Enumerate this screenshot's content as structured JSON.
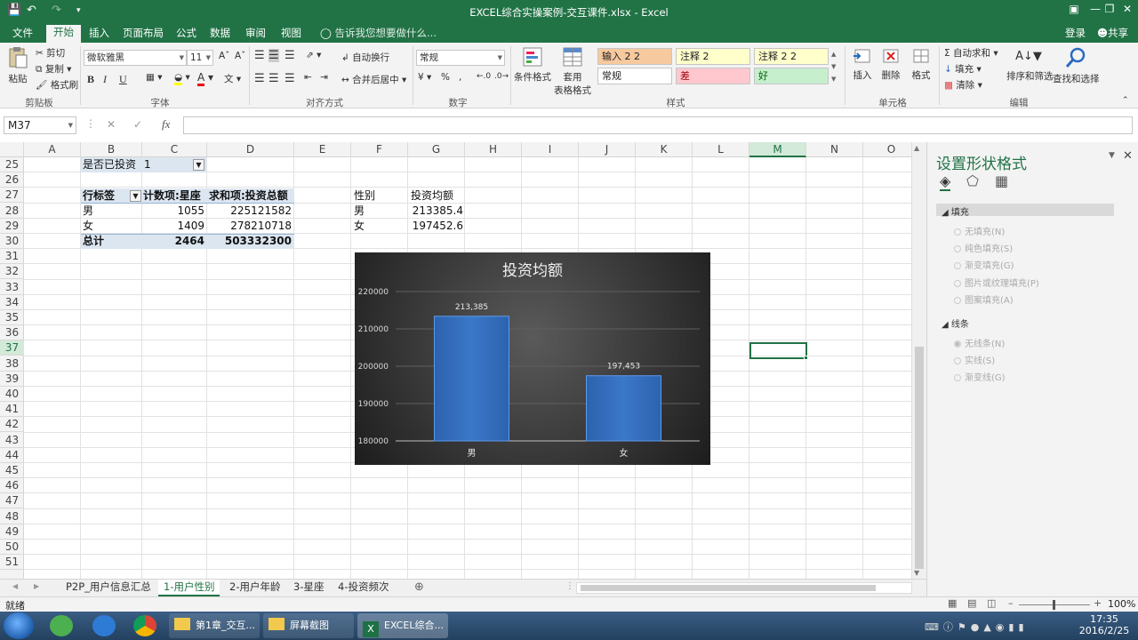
{
  "window": {
    "title": "EXCEL综合实操案例-交互课件.xlsx - Excel"
  },
  "ribbon_tabs": [
    "文件",
    "开始",
    "插入",
    "页面布局",
    "公式",
    "数据",
    "审阅",
    "视图"
  ],
  "tell_me": "告诉我您想要做什么...",
  "account": {
    "login": "登录",
    "share": "共享"
  },
  "clipboard": {
    "paste": "粘贴",
    "cut": "剪切",
    "copy": "复制",
    "format_painter": "格式刷",
    "label": "剪贴板"
  },
  "font": {
    "name": "微软雅黑",
    "size": "11",
    "bold": "B",
    "italic": "I",
    "underline": "U",
    "label": "字体"
  },
  "alignment": {
    "wrap": "自动换行",
    "merge": "合并后居中",
    "label": "对齐方式"
  },
  "number": {
    "format": "常规",
    "label": "数字"
  },
  "styles": {
    "cond": "条件格式",
    "table1": "套用",
    "table2": "表格格式",
    "label": "样式",
    "cells": [
      {
        "text": "输入 2 2",
        "bg": "#f7c99e"
      },
      {
        "text": "注释 2",
        "bg": "#ffffcc"
      },
      {
        "text": "注释 2 2",
        "bg": "#ffffcc"
      },
      {
        "text": "常规",
        "bg": "#ffffff"
      },
      {
        "text": "差",
        "bg": "#ffc7ce"
      },
      {
        "text": "好",
        "bg": "#c6efce"
      }
    ]
  },
  "cells_group": {
    "insert": "插入",
    "delete": "删除",
    "format": "格式",
    "label": "单元格"
  },
  "editing": {
    "autosum": "自动求和",
    "fill": "填充",
    "clear": "清除",
    "sort": "排序和筛选",
    "find": "查找和选择",
    "label": "编辑"
  },
  "formula_bar": {
    "name_box": "M37",
    "fx": "fx",
    "value": ""
  },
  "columns": [
    "A",
    "B",
    "C",
    "D",
    "E",
    "F",
    "G",
    "H",
    "I",
    "J",
    "K",
    "L",
    "M",
    "N",
    "O"
  ],
  "rows": [
    "25",
    "26",
    "27",
    "28",
    "29",
    "30",
    "31",
    "32",
    "33",
    "34",
    "35",
    "36",
    "37",
    "38",
    "39",
    "40",
    "41",
    "42",
    "43",
    "44",
    "45",
    "46",
    "47",
    "48",
    "49",
    "50",
    "51"
  ],
  "pivot": {
    "filter_label": "是否已投资",
    "filter_value": "1",
    "headers": [
      "行标签",
      "计数项:星座",
      "求和项:投资总额"
    ],
    "rows": [
      [
        "男",
        "1055",
        "225121582"
      ],
      [
        "女",
        "1409",
        "278210718"
      ]
    ],
    "total": [
      "总计",
      "2464",
      "503332300"
    ]
  },
  "avg_table": {
    "headers": [
      "性别",
      "投资均额"
    ],
    "rows": [
      [
        "男",
        "213385.4"
      ],
      [
        "女",
        "197452.6"
      ]
    ]
  },
  "chart_data": {
    "type": "bar",
    "title": "投资均额",
    "categories": [
      "男",
      "女"
    ],
    "values": [
      213385,
      197453
    ],
    "data_labels": [
      "213,385",
      "197,453"
    ],
    "ylim": [
      180000,
      220000
    ],
    "yticks": [
      "220000",
      "210000",
      "200000",
      "190000",
      "180000"
    ],
    "grid": true,
    "bar_color": "#3a78c8"
  },
  "format_pane": {
    "title": "设置形状格式",
    "fill_section": "填充",
    "fill_options": [
      "无填充(N)",
      "纯色填充(S)",
      "渐变填充(G)",
      "图片或纹理填充(P)",
      "图案填充(A)"
    ],
    "line_section": "线条",
    "line_options": [
      "无线条(N)",
      "实线(S)",
      "渐变线(G)"
    ]
  },
  "sheet_tabs": [
    "P2P_用户信息汇总",
    "1-用户性别",
    "2-用户年龄",
    "3-星座",
    "4-投资频次"
  ],
  "status": {
    "ready": "就绪",
    "zoom": "100%"
  },
  "taskbar": {
    "items": [
      "第1章_交互...",
      "屏幕截图",
      "EXCEL综合..."
    ],
    "time": "17:35",
    "date": "2016/2/25"
  }
}
